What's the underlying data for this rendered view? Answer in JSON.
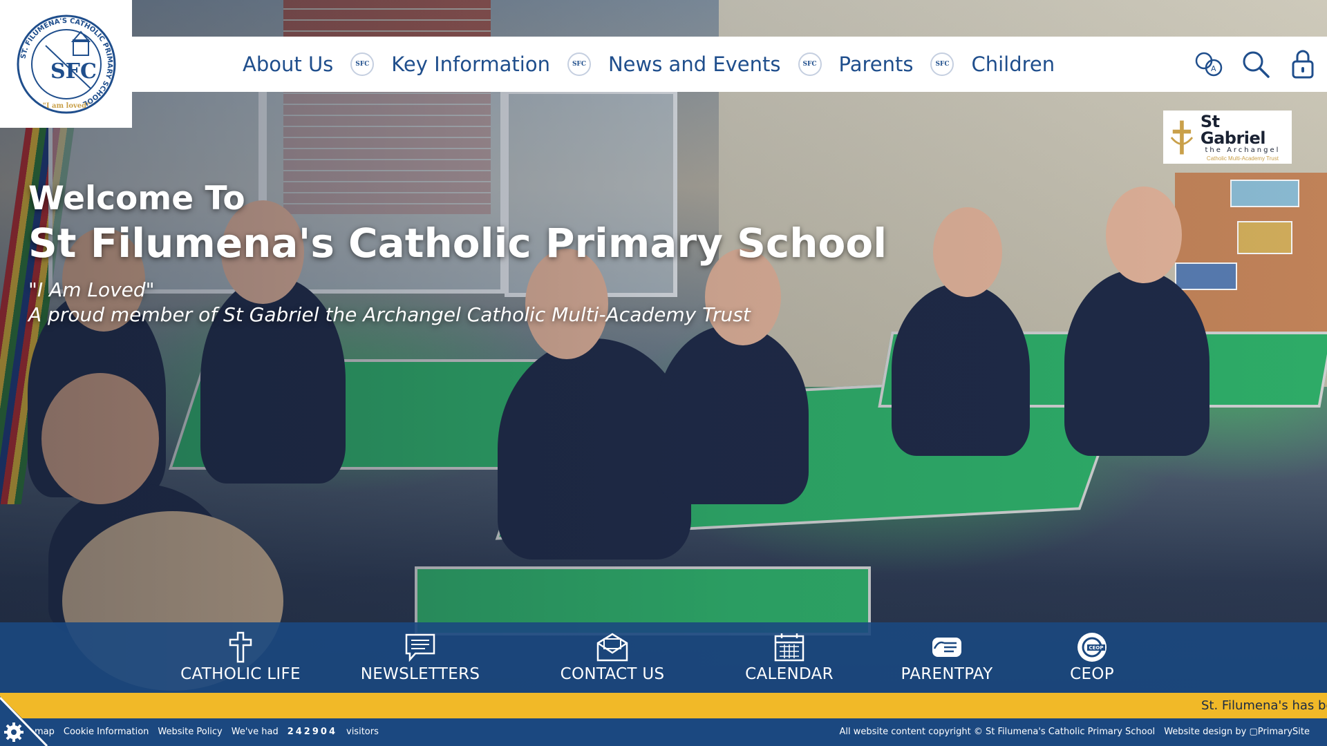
{
  "header": {
    "logo": {
      "ring_text": "ST. FILUMENA'S CATHOLIC PRIMARY SCHOOL",
      "initials": "SFC",
      "motto": "\"I am loved\""
    },
    "nav": [
      {
        "label": "About Us"
      },
      {
        "label": "Key Information"
      },
      {
        "label": "News and Events"
      },
      {
        "label": "Parents"
      },
      {
        "label": "Children"
      }
    ],
    "separator_text": "SFC",
    "tools": {
      "translate_icon": "translate-icon",
      "search_icon": "search-icon",
      "login_icon": "lock-icon"
    }
  },
  "trust_badge": {
    "name": "St Gabriel",
    "sub": "the Archangel",
    "tagline": "Catholic Multi-Academy Trust"
  },
  "hero": {
    "welcome": "Welcome To",
    "school_name": "St Filumena's Catholic Primary School",
    "motto": "\"I Am Loved\"",
    "member_line": "A proud member of St Gabriel the Archangel Catholic Multi-Academy Trust"
  },
  "quick_links": [
    {
      "label": "CATHOLIC LIFE",
      "icon": "cross-icon"
    },
    {
      "label": "NEWSLETTERS",
      "icon": "chat-icon"
    },
    {
      "label": "CONTACT US",
      "icon": "envelope-icon"
    },
    {
      "label": "CALENDAR",
      "icon": "calendar-icon"
    },
    {
      "label": "PARENTPAY",
      "icon": "wallet-icon"
    },
    {
      "label": "CEOP",
      "icon": "ceop-icon"
    }
  ],
  "ticker": {
    "text": "St. Filumena's has be"
  },
  "footer": {
    "sitemap": "map",
    "cookie": "Cookie Information",
    "policy": "Website Policy",
    "visitors_prefix": "We've had",
    "visitors_count": "242904",
    "visitors_suffix": "visitors",
    "copyright": "All website content copyright © St Filumena's Catholic Primary School",
    "design_prefix": "Website design by",
    "design_brand": "PrimarySite"
  },
  "colors": {
    "navy": "#1b4880",
    "nav_text": "#1f4e8c",
    "ticker_yellow": "#f1b928",
    "white": "#ffffff"
  }
}
